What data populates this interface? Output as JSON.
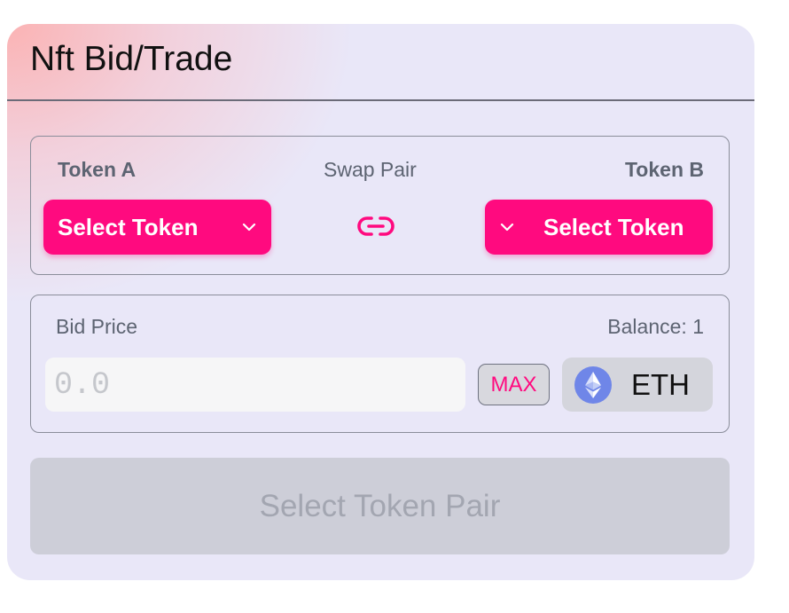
{
  "card": {
    "title": "Nft Bid/Trade"
  },
  "pair": {
    "token_a_label": "Token A",
    "swap_label": "Swap Pair",
    "token_b_label": "Token B",
    "token_a_button": "Select Token",
    "token_b_button": "Select Token",
    "swap_icon": "link-icon"
  },
  "bid": {
    "label": "Bid Price",
    "balance": "Balance: 1",
    "amount_placeholder": "0.0",
    "max_label": "MAX",
    "currency": "ETH",
    "currency_icon": "eth-icon"
  },
  "submit": {
    "label": "Select Token Pair"
  },
  "colors": {
    "accent": "#ff0a7f",
    "card_bg": "#e9e7f8",
    "disabled_bg": "#cdced8",
    "disabled_text": "#a3a6b1"
  }
}
